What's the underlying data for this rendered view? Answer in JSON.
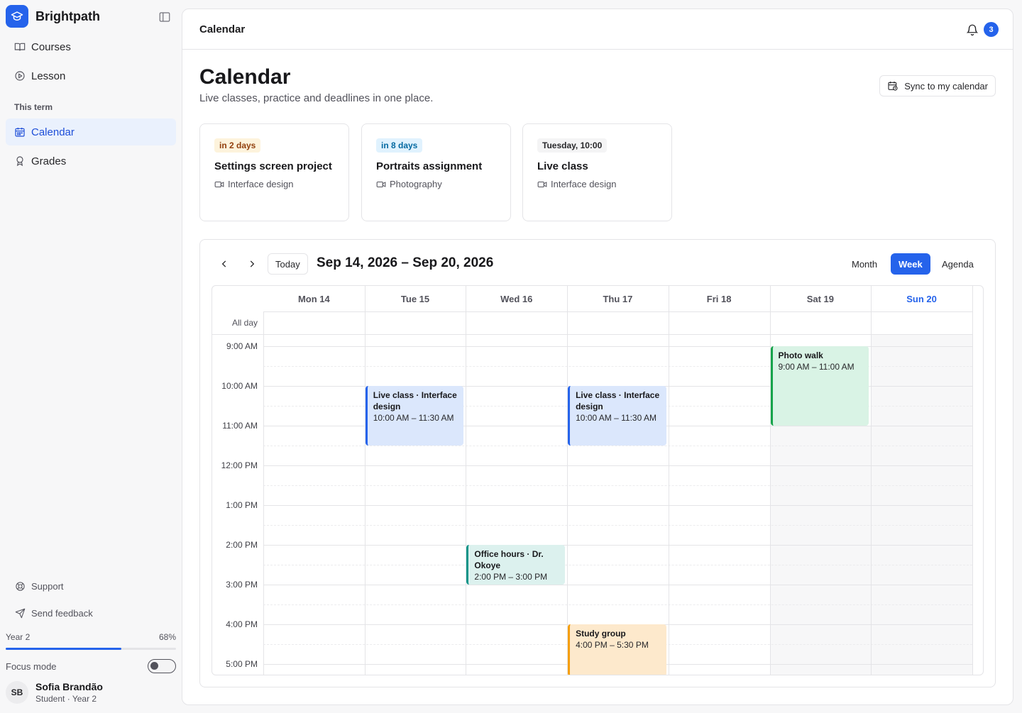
{
  "sidebar": {
    "brand": "Brightpath",
    "nav": [
      {
        "label": "Courses",
        "icon": "book-icon"
      },
      {
        "label": "Lesson",
        "icon": "play-circle-icon"
      }
    ],
    "section_label": "This term",
    "term_nav": [
      {
        "label": "Calendar",
        "icon": "calendar-icon",
        "active": true
      },
      {
        "label": "Grades",
        "icon": "award-icon"
      }
    ],
    "footer_links": [
      {
        "label": "Support",
        "icon": "lifebuoy-icon"
      },
      {
        "label": "Send feedback",
        "icon": "send-icon"
      }
    ],
    "progress": {
      "label": "Year 2",
      "value_text": "68%",
      "value": 0.68
    },
    "focus_mode": {
      "label": "Focus mode",
      "on": false
    },
    "user": {
      "initials": "SB",
      "name": "Sofia Brandão",
      "subtitle": "Student · Year 2"
    }
  },
  "topbar": {
    "title": "Calendar",
    "notification_count": "3"
  },
  "page": {
    "title": "Calendar",
    "subtitle": "Live classes, practice and deadlines in one place.",
    "sync_label": "Sync to my calendar"
  },
  "cards": [
    {
      "pill": "in 2 days",
      "pill_style": "amber",
      "title": "Settings screen project",
      "meta": "Interface design"
    },
    {
      "pill": "in 8 days",
      "pill_style": "blue",
      "title": "Portraits assignment",
      "meta": "Photography"
    },
    {
      "pill": "Tuesday, 10:00",
      "pill_style": "gray",
      "title": "Live class",
      "meta": "Interface design"
    }
  ],
  "calendar": {
    "today_label": "Today",
    "range": "Sep 14, 2026 – Sep 20, 2026",
    "views": [
      "Month",
      "Week",
      "Agenda"
    ],
    "active_view": "Week",
    "all_day_label": "All day",
    "days": [
      "Mon 14",
      "Tue 15",
      "Wed 16",
      "Thu 17",
      "Fri 18",
      "Sat 19",
      "Sun 20"
    ],
    "today_index": 6,
    "time_labels": [
      "9:00 AM",
      "10:00 AM",
      "11:00 AM",
      "12:00 PM",
      "1:00 PM",
      "2:00 PM",
      "3:00 PM",
      "4:00 PM",
      "5:00 PM"
    ],
    "events": [
      {
        "title": "Live class · Interface design",
        "time": "10:00 AM – 11:30 AM",
        "day": 1,
        "start": 10,
        "end": 11.5,
        "style": "blue"
      },
      {
        "title": "Live class · Interface design",
        "time": "10:00 AM – 11:30 AM",
        "day": 3,
        "start": 10,
        "end": 11.5,
        "style": "blue"
      },
      {
        "title": "Photo walk",
        "time": "9:00 AM – 11:00 AM",
        "day": 5,
        "start": 9,
        "end": 11,
        "style": "green"
      },
      {
        "title": "Office hours · Dr. Okoye",
        "time": "2:00 PM – 3:00 PM",
        "day": 2,
        "start": 14,
        "end": 15,
        "style": "teal"
      },
      {
        "title": "Study group",
        "time": "4:00 PM – 5:30 PM",
        "day": 3,
        "start": 16,
        "end": 17.5,
        "style": "amber"
      }
    ]
  }
}
